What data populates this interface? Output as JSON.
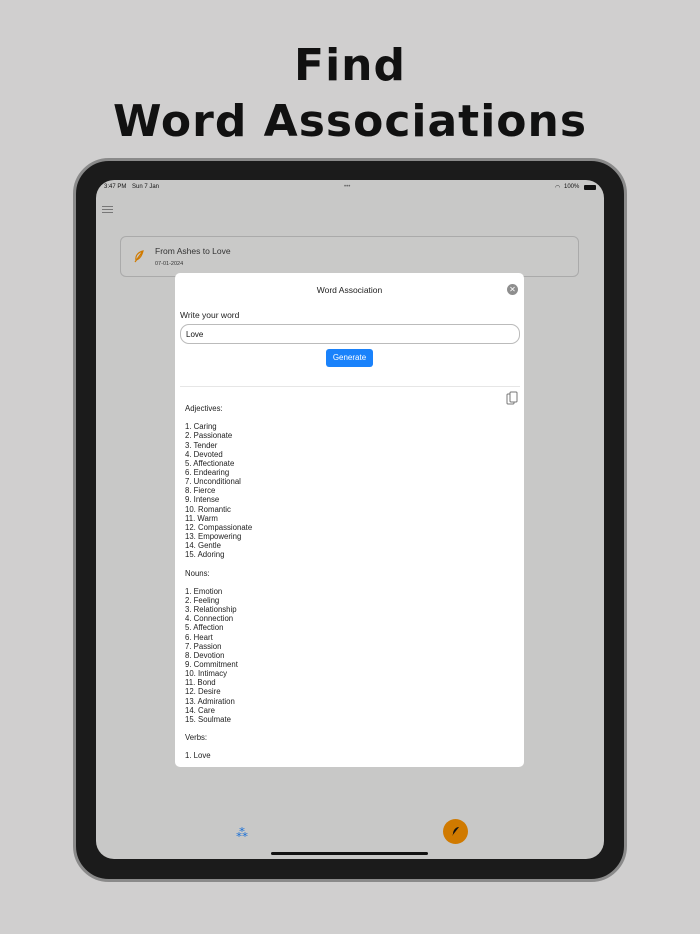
{
  "headline": {
    "line1": "Find",
    "line2": "Word Associations"
  },
  "status": {
    "time": "3:47 PM",
    "date": "Sun 7 Jan",
    "dots": "•••",
    "battery": "100%"
  },
  "card": {
    "title": "From Ashes to Love",
    "date": "07-01-2024"
  },
  "modal": {
    "title": "Word Association",
    "close": "✕",
    "label": "Write your word",
    "input_value": "Love",
    "generate": "Generate"
  },
  "results": [
    {
      "heading": "Adjectives:",
      "items": [
        "1. Caring",
        "2. Passionate",
        "3. Tender",
        "4. Devoted",
        "5. Affectionate",
        "6. Endearing",
        "7. Unconditional",
        "8. Fierce",
        "9. Intense",
        "10. Romantic",
        "11. Warm",
        "12. Compassionate",
        "13. Empowering",
        "14. Gentle",
        "15. Adoring"
      ]
    },
    {
      "heading": "Nouns:",
      "items": [
        "1. Emotion",
        "2. Feeling",
        "3. Relationship",
        "4. Connection",
        "5. Affection",
        "6. Heart",
        "7. Passion",
        "8. Devotion",
        "9. Commitment",
        "10. Intimacy",
        "11. Bond",
        "12. Desire",
        "13. Admiration",
        "14. Care",
        "15. Soulmate"
      ]
    },
    {
      "heading": "Verbs:",
      "items": [
        "1. Love"
      ]
    }
  ],
  "colors": {
    "accent": "#1a82fb",
    "fab": "#d07a00"
  }
}
